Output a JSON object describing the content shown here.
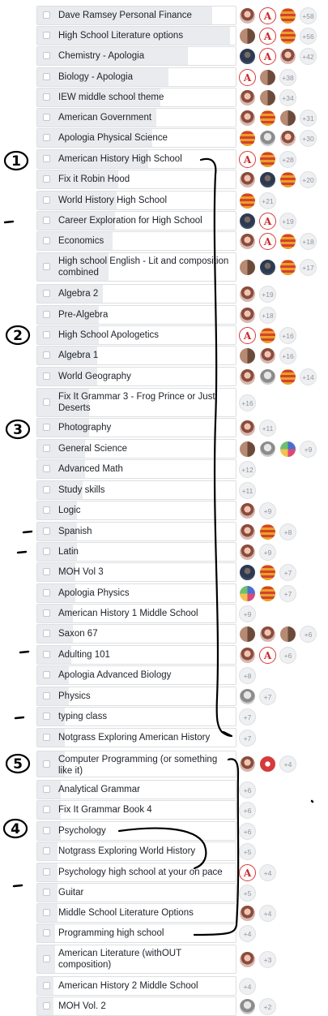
{
  "poll": {
    "options": [
      {
        "label": "Dave Ramsey Personal Finance",
        "share": 0.88,
        "voters": [
          "person-photo",
          "logo-a",
          "flag"
        ],
        "more": "+58"
      },
      {
        "label": "High School Literature options",
        "share": 0.97,
        "voters": [
          "couple-photo",
          "logo-a",
          "flag"
        ],
        "more": "+56"
      },
      {
        "label": "Chemistry - Apologia",
        "share": 0.76,
        "voters": [
          "dark-photo",
          "logo-a",
          "person-photo"
        ],
        "more": "+42"
      },
      {
        "label": "Biology - Apologia",
        "share": 0.66,
        "voters": [
          "logo-a",
          "couple-photo"
        ],
        "more": "+38"
      },
      {
        "label": "IEW middle school theme",
        "share": 0.62,
        "voters": [
          "person-photo",
          "couple-photo"
        ],
        "more": "+34"
      },
      {
        "label": "American Government",
        "share": 0.6,
        "voters": [
          "person-photo",
          "flag",
          "couple-photo"
        ],
        "more": "+31"
      },
      {
        "label": "Apologia Physical Science",
        "share": 0.58,
        "voters": [
          "flag",
          "gray-photo",
          "person-photo"
        ],
        "more": "+30"
      },
      {
        "label": "American History High School",
        "share": 0.56,
        "voters": [
          "logo-a",
          "flag"
        ],
        "more": "+28"
      },
      {
        "label": "Fix it Robin Hood",
        "share": 0.41,
        "voters": [
          "person-photo",
          "dark-photo",
          "flag"
        ],
        "more": "+20"
      },
      {
        "label": "World History High School",
        "share": 0.4,
        "voters": [
          "flag"
        ],
        "more": "+21"
      },
      {
        "label": "Career Exploration for High School",
        "share": 0.39,
        "voters": [
          "dark-photo",
          "logo-a"
        ],
        "more": "+19"
      },
      {
        "label": "Economics",
        "share": 0.38,
        "voters": [
          "person-photo",
          "logo-a",
          "flag"
        ],
        "more": "+18"
      },
      {
        "label": "High school English - Lit and composition combined",
        "share": 0.36,
        "voters": [
          "couple-photo",
          "dark-photo",
          "flag"
        ],
        "more": "+17"
      },
      {
        "label": "Algebra 2",
        "share": 0.33,
        "voters": [
          "person-photo"
        ],
        "more": "+19"
      },
      {
        "label": "Pre-Algebra",
        "share": 0.31,
        "voters": [
          "person-photo"
        ],
        "more": "+18"
      },
      {
        "label": "High School Apologetics",
        "share": 0.31,
        "voters": [
          "logo-a",
          "flag"
        ],
        "more": "+16"
      },
      {
        "label": "Algebra 1",
        "share": 0.3,
        "voters": [
          "couple-photo",
          "person-photo"
        ],
        "more": "+16"
      },
      {
        "label": "World Geography",
        "share": 0.3,
        "voters": [
          "person-photo",
          "gray-photo",
          "flag"
        ],
        "more": "+14"
      },
      {
        "label": "Fix It Grammar 3 - Frog Prince or Just Deserts",
        "share": 0.26,
        "voters": [],
        "more": "+16"
      },
      {
        "label": "Photography",
        "share": 0.26,
        "voters": [
          "person-photo"
        ],
        "more": "+11"
      },
      {
        "label": "General Science",
        "share": 0.24,
        "voters": [
          "couple-photo",
          "gray-photo",
          "mixed-photo"
        ],
        "more": "+9"
      },
      {
        "label": "Advanced Math",
        "share": 0.24,
        "voters": [],
        "more": "+12"
      },
      {
        "label": "Study skills",
        "share": 0.23,
        "voters": [],
        "more": "+11"
      },
      {
        "label": "Logic",
        "share": 0.2,
        "voters": [
          "person-photo"
        ],
        "more": "+9"
      },
      {
        "label": "Spanish",
        "share": 0.2,
        "voters": [
          "person-photo",
          "flag"
        ],
        "more": "+8"
      },
      {
        "label": "Latin",
        "share": 0.2,
        "voters": [
          "person-photo"
        ],
        "more": "+9"
      },
      {
        "label": "MOH Vol 3",
        "share": 0.19,
        "voters": [
          "dark-photo",
          "flag"
        ],
        "more": "+7"
      },
      {
        "label": "Apologia Physics",
        "share": 0.19,
        "voters": [
          "mixed-photo",
          "flag"
        ],
        "more": "+7"
      },
      {
        "label": "American History 1 Middle School",
        "share": 0.18,
        "voters": [],
        "more": "+9"
      },
      {
        "label": "Saxon 67",
        "share": 0.18,
        "voters": [
          "couple-photo",
          "person-photo",
          "couple-photo"
        ],
        "more": "+6"
      },
      {
        "label": "Adulting 101",
        "share": 0.17,
        "voters": [
          "person-photo",
          "logo-a"
        ],
        "more": "+6"
      },
      {
        "label": "Apologia Advanced Biology",
        "share": 0.16,
        "voters": [],
        "more": "+8"
      },
      {
        "label": "Physics",
        "share": 0.16,
        "voters": [
          "gray-photo"
        ],
        "more": "+7"
      },
      {
        "label": "typing class",
        "share": 0.14,
        "voters": [],
        "more": "+7"
      },
      {
        "label": "Notgrass Exploring American History",
        "share": 0.14,
        "voters": [],
        "more": "+7"
      },
      {
        "label": "Computer Programming (or something like it)",
        "share": 0.14,
        "voters": [
          "person-photo",
          "red-photo"
        ],
        "more": "+4"
      },
      {
        "label": "Analytical Grammar",
        "share": 0.12,
        "voters": [],
        "more": "+6"
      },
      {
        "label": "Fix It Grammar Book 4",
        "share": 0.12,
        "voters": [],
        "more": "+6"
      },
      {
        "label": "Psychology",
        "share": 0.12,
        "voters": [],
        "more": "+6"
      },
      {
        "label": "Notgrass Exploring World History",
        "share": 0.1,
        "voters": [],
        "more": "+5"
      },
      {
        "label": "Psychology high school at your on pace",
        "share": 0.1,
        "voters": [
          "logo-a"
        ],
        "more": "+4"
      },
      {
        "label": "Guitar",
        "share": 0.1,
        "voters": [],
        "more": "+5"
      },
      {
        "label": "Middle School Literature Options",
        "share": 0.1,
        "voters": [
          "person-photo"
        ],
        "more": "+4"
      },
      {
        "label": "Programming high school",
        "share": 0.09,
        "voters": [],
        "more": "+4"
      },
      {
        "label": "American Literature (withOUT composition)",
        "share": 0.09,
        "voters": [
          "person-photo"
        ],
        "more": "+3"
      },
      {
        "label": "American History 2 Middle School",
        "share": 0.08,
        "voters": [],
        "more": "+4"
      },
      {
        "label": "MOH Vol. 2",
        "share": 0.08,
        "voters": [
          "gray-photo"
        ],
        "more": "+2"
      }
    ]
  },
  "annotations": {
    "numbers": [
      "1",
      "2",
      "3",
      "4",
      "5"
    ],
    "ink_color": "#000000"
  },
  "colors": {
    "fill": "#e9ebee",
    "border": "#dddfe2",
    "text": "#1d2129",
    "more_text": "#90949c",
    "logo_red": "#d93838"
  }
}
